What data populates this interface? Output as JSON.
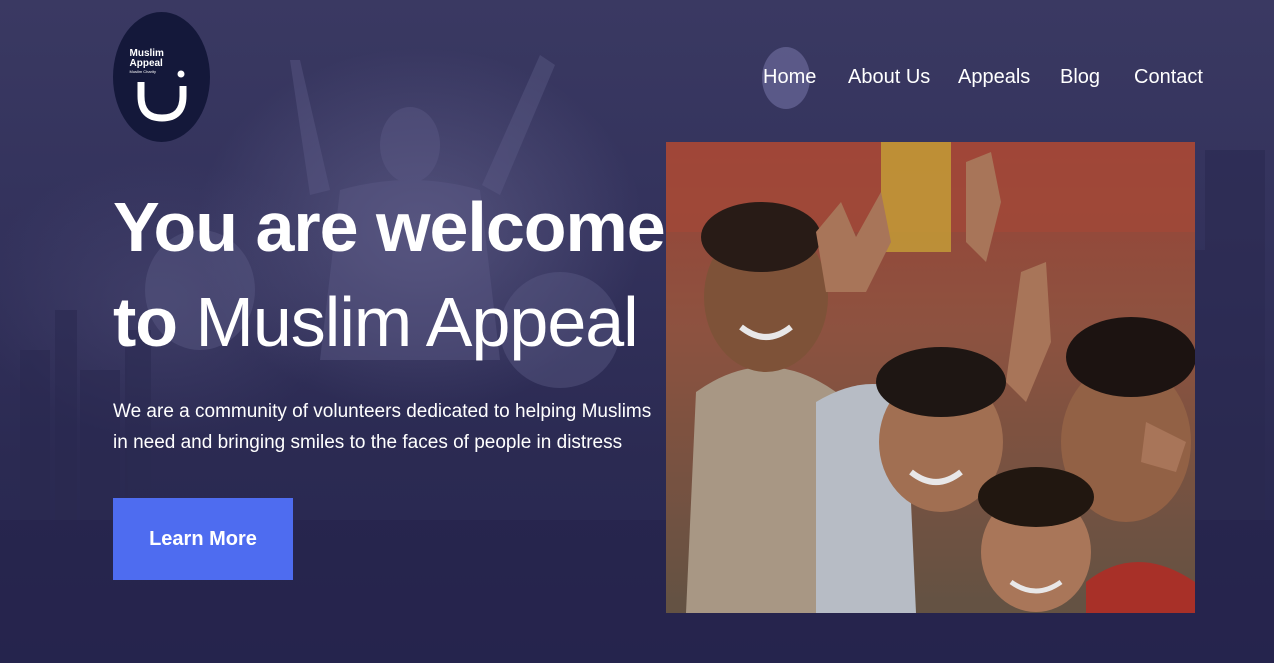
{
  "logo": {
    "title_line1": "Muslim",
    "title_line2": "Appeal",
    "subtitle": "Muslim Charity"
  },
  "nav": {
    "items": [
      {
        "label": "Home",
        "active": true
      },
      {
        "label": "About Us",
        "active": false
      },
      {
        "label": "Appeals",
        "active": false
      },
      {
        "label": "Blog",
        "active": false
      },
      {
        "label": "Contact",
        "active": false
      }
    ]
  },
  "hero": {
    "headline_line1": "You are welcome",
    "headline_line2_bold": "to",
    "headline_line2_rest": " Muslim Appeal",
    "description": "We are a community of volunteers dedicated to helping Muslims in need and bringing smiles to the faces of people in distress",
    "cta_label": "Learn More"
  },
  "colors": {
    "background": "#2c2b52",
    "logo_bg": "#14183a",
    "cta": "#4e6cf0",
    "text": "#ffffff"
  }
}
